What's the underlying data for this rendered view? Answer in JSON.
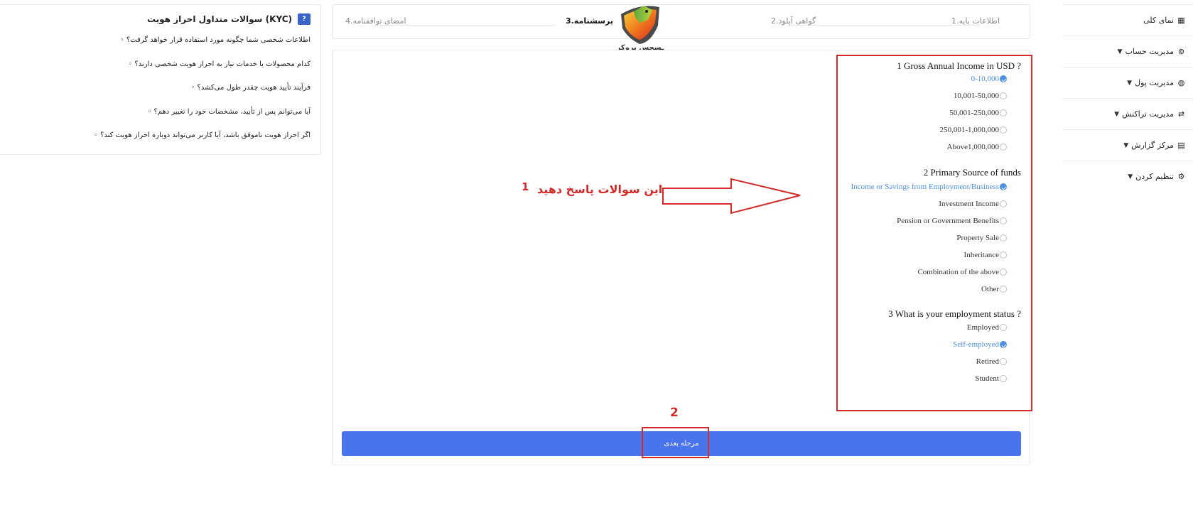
{
  "sidebar": {
    "items": [
      {
        "label": "نمای کلی",
        "icon": "grid-icon",
        "has_caret": false
      },
      {
        "label": "مدیریت حساب",
        "icon": "wallet-icon",
        "has_caret": true
      },
      {
        "label": "مدیریت پول",
        "icon": "money-icon",
        "has_caret": true
      },
      {
        "label": "مدیریت تراکنش",
        "icon": "transfer-icon",
        "has_caret": true
      },
      {
        "label": "مرکز گزارش",
        "icon": "report-icon",
        "has_caret": true
      },
      {
        "label": "تنظیم کردن",
        "icon": "settings-icon",
        "has_caret": true
      }
    ]
  },
  "steps": [
    {
      "label": "1.اطلاعات پایه",
      "active": false
    },
    {
      "label": "2.گواهی آپلود",
      "active": false
    },
    {
      "label": "3.پرسشنامه",
      "active": true
    },
    {
      "label": "4.امضای توافقنامه",
      "active": false
    }
  ],
  "logo": {
    "text": "ـسجس بروکر"
  },
  "faq": {
    "title": "سوالات متداول احراز هویت (KYC)",
    "badge": "?",
    "questions": [
      "اطلاعات شخصی شما چگونه مورد استفاده قرار خواهد گرفت؟ ◦",
      "کدام محصولات یا خدمات نیاز به احراز هویت شخصی دارند؟ ◦",
      "فرآیند تأیید هویت چقدر طول می‌کشد؟ ◦",
      "آیا می‌توانم پس از تأیید، مشخصات خود را تغییر دهم؟ ◦",
      "اگر احراز هویت ناموفق باشد، آیا کاربر می‌تواند دوباره احراز هویت کند؟ ◦"
    ]
  },
  "questions": [
    {
      "title": "1 Gross Annual Income in USD ?",
      "options": [
        {
          "label": "0-10,000",
          "selected": true
        },
        {
          "label": "10,001-50,000",
          "selected": false
        },
        {
          "label": "50,001-250,000",
          "selected": false
        },
        {
          "label": "250,001-1,000,000",
          "selected": false
        },
        {
          "label": "Above1,000,000",
          "selected": false
        }
      ]
    },
    {
      "title": "2 Primary Source of funds",
      "options": [
        {
          "label": "Income or Savings from Employment/Business",
          "selected": true
        },
        {
          "label": "Investment Income",
          "selected": false
        },
        {
          "label": "Pension or Government Benefits",
          "selected": false
        },
        {
          "label": "Property Sale",
          "selected": false
        },
        {
          "label": "Inheritance",
          "selected": false
        },
        {
          "label": "Combination of the above",
          "selected": false
        },
        {
          "label": "Other",
          "selected": false
        }
      ]
    },
    {
      "title": "3 What is your employment status ?",
      "options": [
        {
          "label": "Employed",
          "selected": false
        },
        {
          "label": "Self-employed",
          "selected": true
        },
        {
          "label": "Retired",
          "selected": false
        },
        {
          "label": "Student",
          "selected": false
        }
      ]
    }
  ],
  "annotations": {
    "step1_text": "به این سوالات پاسخ دهید",
    "step1_num": "1",
    "step2_num": "2"
  },
  "next_button": {
    "label": "مرحله بعدی"
  },
  "colors": {
    "accent": "#4a74ec",
    "selected": "#4d8fe0",
    "annotation": "#d42a2a"
  }
}
